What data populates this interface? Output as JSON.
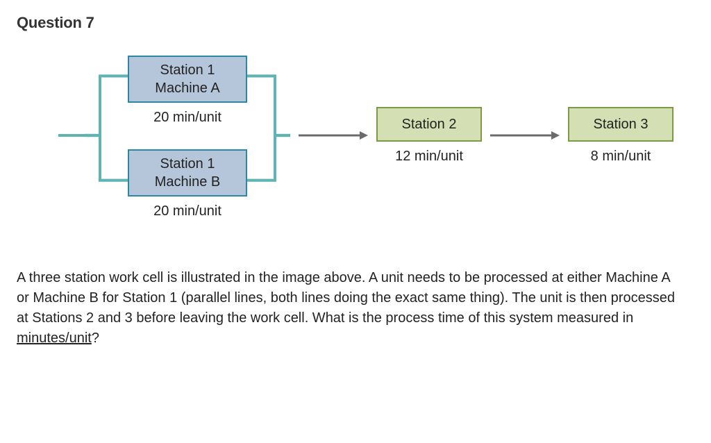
{
  "question": {
    "label": "Question 7",
    "text": "A three station work cell is illustrated in the image above. A unit needs to be processed at either Machine A or Machine B for Station 1 (parallel lines, both lines doing the exact same thing). The unit is then processed at Stations 2 and 3 before leaving the work cell. What is the process time of this system measured in ",
    "underlined": "minutes/unit",
    "trailing": "?"
  },
  "diagram": {
    "station1a": {
      "line1": "Station 1",
      "line2": "Machine A",
      "rate": "20 min/unit"
    },
    "station1b": {
      "line1": "Station 1",
      "line2": "Machine B",
      "rate": "20 min/unit"
    },
    "station2": {
      "label": "Station 2",
      "rate": "12 min/unit"
    },
    "station3": {
      "label": "Station 3",
      "rate": "8 min/unit"
    }
  },
  "chart_data": {
    "type": "table",
    "title": "Work cell processing times",
    "stations": [
      {
        "station": "Station 1",
        "machine": "Machine A",
        "time_min_per_unit": 20,
        "parallel_group": 1
      },
      {
        "station": "Station 1",
        "machine": "Machine B",
        "time_min_per_unit": 20,
        "parallel_group": 1
      },
      {
        "station": "Station 2",
        "machine": null,
        "time_min_per_unit": 12,
        "parallel_group": null
      },
      {
        "station": "Station 3",
        "machine": null,
        "time_min_per_unit": 8,
        "parallel_group": null
      }
    ],
    "flow": "Station 1 (A ∥ B) → Station 2 → Station 3"
  }
}
